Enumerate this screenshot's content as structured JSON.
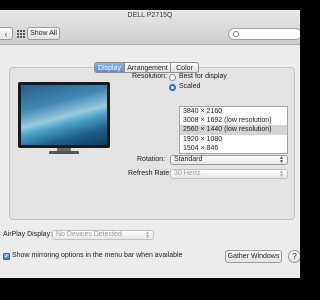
{
  "window": {
    "title": "DELL P2715Q"
  },
  "toolbar": {
    "back_icon": "‹",
    "show_all_label": "Show All"
  },
  "tabs": [
    {
      "label": "Display",
      "selected": true
    },
    {
      "label": "Arrangement",
      "selected": false
    },
    {
      "label": "Color",
      "selected": false
    }
  ],
  "resolution": {
    "label": "Resolution:",
    "options": [
      {
        "label": "Best for display",
        "selected": false
      },
      {
        "label": "Scaled",
        "selected": true
      }
    ],
    "list": [
      {
        "label": "3840 × 2160",
        "selected": false
      },
      {
        "label": "3008 × 1692 (low resolution)",
        "selected": false
      },
      {
        "label": "2560 × 1440 (low resolution)",
        "selected": true
      },
      {
        "label": "1920 × 1080",
        "selected": false
      },
      {
        "label": "1504 × 846",
        "selected": false
      }
    ]
  },
  "rotation": {
    "label": "Rotation:",
    "value": "Standard"
  },
  "refresh_rate": {
    "label": "Refresh Rate:",
    "value": "30 Hertz",
    "disabled": true
  },
  "airplay": {
    "label": "AirPlay Display:",
    "value": "No Devices Detected",
    "disabled": true
  },
  "mirroring": {
    "label": "Show mirroring options in the menu bar when available",
    "checked": true
  },
  "buttons": {
    "gather_windows": "Gather Windows",
    "help": "?"
  },
  "colors": {
    "accent": "#4c85d6",
    "window_bg": "#ececec"
  }
}
